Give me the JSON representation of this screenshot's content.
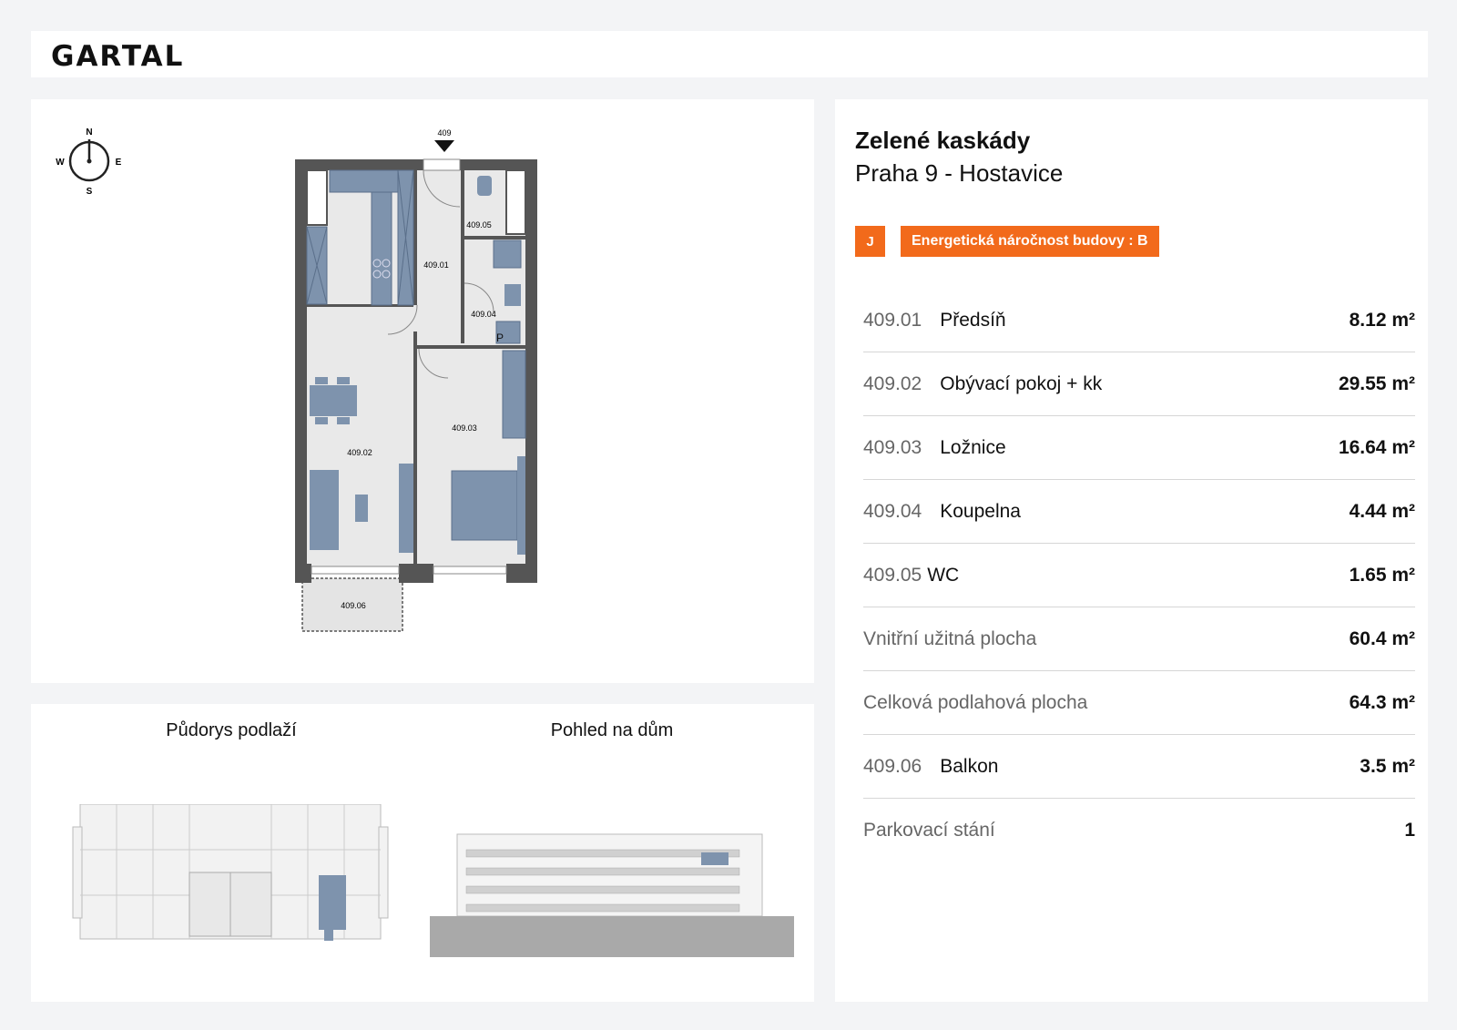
{
  "brand": {
    "logo": "GARTAL"
  },
  "compass": {
    "n": "N",
    "s": "S",
    "e": "E",
    "w": "W"
  },
  "floor_plan": {
    "entrance_label": "409",
    "rooms": {
      "r0901": "409.01",
      "r0902": "409.02",
      "r0903": "409.03",
      "r0904": "409.04",
      "r0905": "409.05",
      "r0906": "409.06"
    },
    "parking_mark": "P"
  },
  "views": {
    "floor_title": "Půdorys podlaží",
    "house_title": "Pohled na dům"
  },
  "project": {
    "name": "Zelené kaskády",
    "location": "Praha 9 - Hostavice"
  },
  "energy": {
    "orientation_badge": "J",
    "label": "Energetická náročnost budovy : B",
    "color": "#f26a1b"
  },
  "rooms": [
    {
      "code": "409.01",
      "name": "Předsíň",
      "area": "8.12 m²"
    },
    {
      "code": "409.02",
      "name": "Obývací pokoj + kk",
      "area": "29.55 m²"
    },
    {
      "code": "409.03",
      "name": "Ložnice",
      "area": "16.64 m²"
    },
    {
      "code": "409.04",
      "name": "Koupelna",
      "area": "4.44 m²"
    },
    {
      "code": "409.05",
      "name": "WC",
      "area": "1.65 m²"
    }
  ],
  "totals": [
    {
      "label": "Vnitřní užitná plocha",
      "area": "60.4 m²"
    },
    {
      "label": "Celková podlahová plocha",
      "area": "64.3 m²"
    }
  ],
  "balcony": {
    "code": "409.06",
    "name": "Balkon",
    "area": "3.5 m²"
  },
  "parking": {
    "label": "Parkovací stání",
    "value": "1"
  }
}
